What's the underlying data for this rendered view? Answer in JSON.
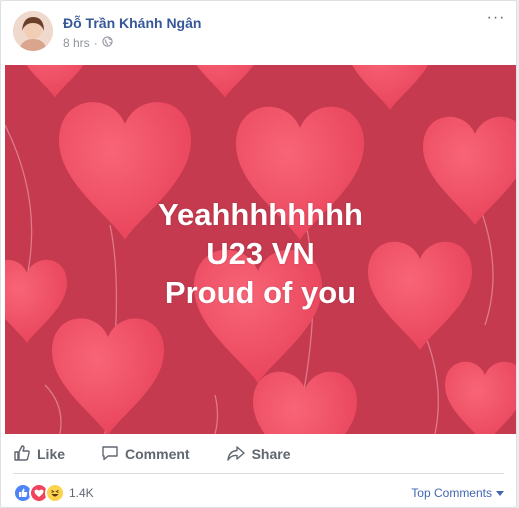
{
  "post": {
    "author": "Đỗ Trần Khánh Ngân",
    "time": "8 hrs",
    "privacy_icon": "globe-icon",
    "image_lines": [
      "Yeahhhhhhhh",
      "U23 VN",
      "Proud of you"
    ],
    "colors": {
      "background": "#c8374d",
      "heart": "#f24e64",
      "text": "#ffffff"
    }
  },
  "actions": {
    "like": "Like",
    "comment": "Comment",
    "share": "Share"
  },
  "footer": {
    "reaction_count": "1.4K",
    "sort_label": "Top Comments",
    "reaction_icons": [
      "like-icon",
      "love-icon",
      "haha-icon"
    ]
  }
}
